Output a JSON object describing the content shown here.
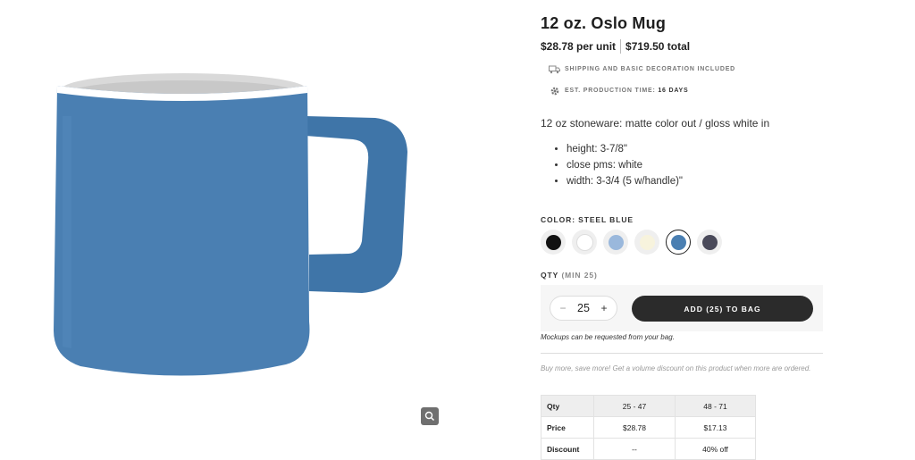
{
  "product": {
    "title": "12 oz. Oslo Mug",
    "unit_price": "$28.78 per unit",
    "total_price": "$719.50 total",
    "features": [
      {
        "icon": "truck-icon",
        "text": "SHIPPING AND BASIC DECORATION INCLUDED"
      },
      {
        "icon": "gear-icon",
        "text": "EST. PRODUCTION TIME:",
        "strong": "16 DAYS"
      }
    ],
    "description": "12 oz stoneware: matte color out / gloss white in",
    "specs": [
      "height: 3-7/8\"",
      "close pms: white",
      "width: 3-3/4 (5 w/handle)\""
    ]
  },
  "color": {
    "label": "COLOR: STEEL BLUE",
    "swatches": [
      {
        "name": "black",
        "hex": "#111111"
      },
      {
        "name": "white",
        "hex": "#ffffff"
      },
      {
        "name": "light blue",
        "hex": "#9ab8dc"
      },
      {
        "name": "cream",
        "hex": "#f7f3dd"
      },
      {
        "name": "steel blue",
        "hex": "#4a7fb2",
        "selected": true
      },
      {
        "name": "charcoal",
        "hex": "#4a4a5a"
      }
    ]
  },
  "quantity": {
    "label": "QTY",
    "min_label": "(MIN 25)",
    "value": "25",
    "minus": "−",
    "plus": "+",
    "add_button": "ADD (25) TO BAG",
    "mockups_note": "Mockups can be requested from your bag."
  },
  "promo": "Buy more, save more! Get a volume discount on this product when more are ordered.",
  "price_table": {
    "rows": [
      [
        "Qty",
        "25 - 47",
        "48 - 71"
      ],
      [
        "Price",
        "$28.78",
        "$17.13"
      ],
      [
        "Discount",
        "--",
        "40% off"
      ]
    ]
  },
  "colors": {
    "mug_body": "#4a7fb2",
    "button_dark": "#2b2b2b"
  }
}
